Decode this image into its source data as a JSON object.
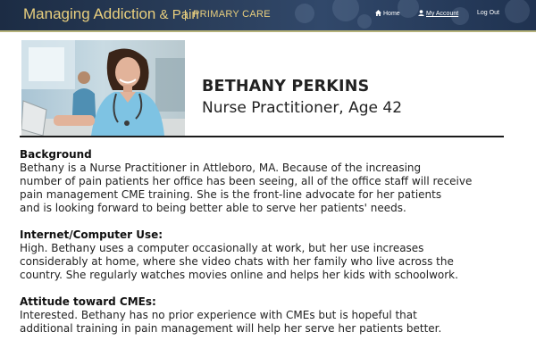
{
  "header": {
    "brand_title": "Managing Addiction",
    "brand_amp": " & Pain",
    "brand_subtitle": "PRIMARY CARE",
    "nav": {
      "home": "Home",
      "my_account": "My Account",
      "log_out": "Log Out"
    }
  },
  "profile": {
    "name": "BETHANY PERKINS",
    "role": "Nurse Practitioner, Age 42"
  },
  "sections": [
    {
      "title": "Background",
      "lines": [
        "Bethany is a Nurse Practitioner in Attleboro, MA. Because of the increasing",
        "number of pain patients her office has been seeing, all of the office staff will receive",
        "pain management CME training. She is the front-line advocate for her patients",
        "and is looking forward to being better able to serve her patients' needs."
      ]
    },
    {
      "title": "Internet/Computer Use:",
      "lines": [
        "High. Bethany uses a computer occasionally at work, but her use increases",
        "considerably at home, where she video chats with her family who live across the",
        "country. She regularly watches movies online and helps her kids with schoolwork."
      ]
    },
    {
      "title": "Attitude toward CMEs:",
      "lines": [
        "Interested. Bethany has no prior experience with CMEs but is hopeful that",
        "additional training in pain management will help her serve her patients better."
      ]
    }
  ]
}
